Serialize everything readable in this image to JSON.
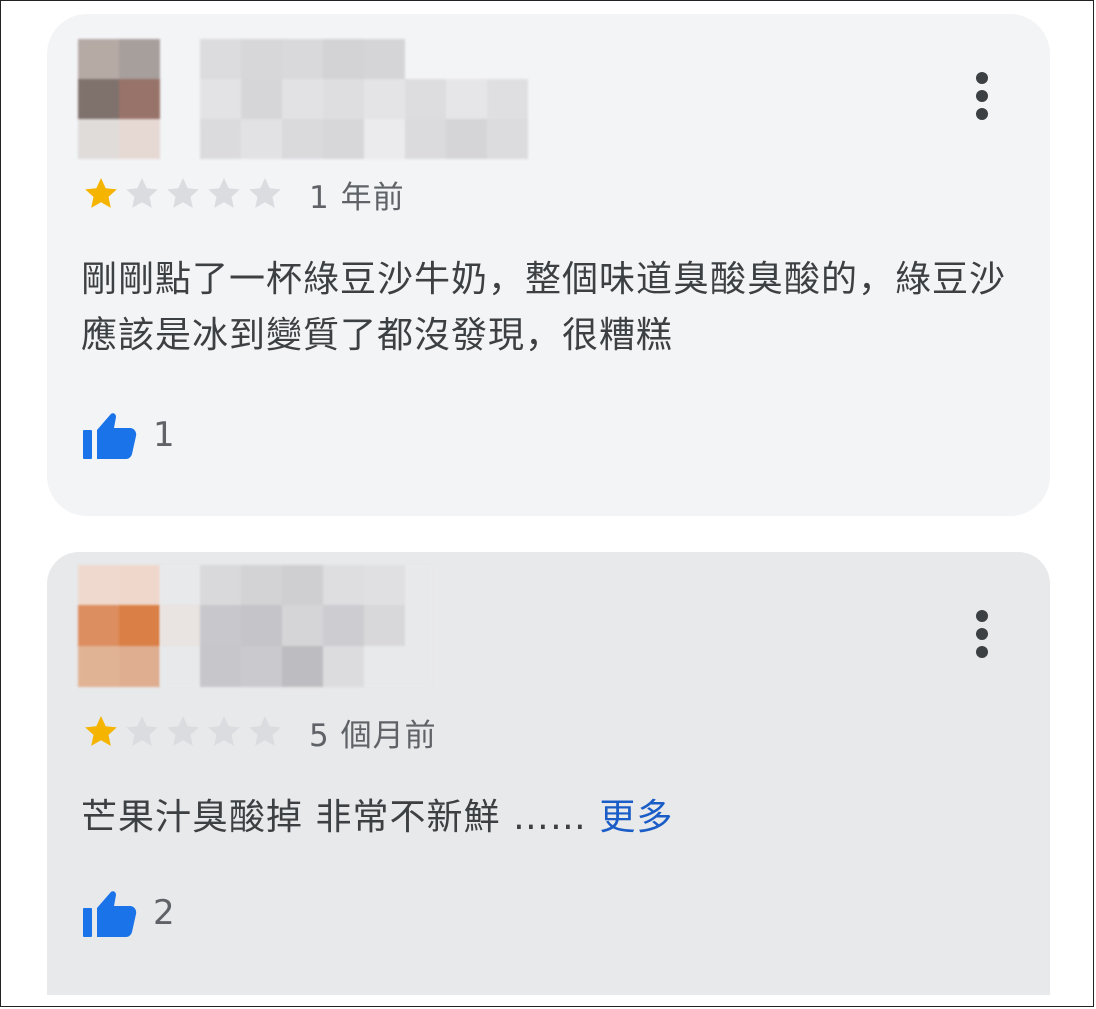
{
  "reviews": [
    {
      "avatar_label": "reviewer avatar (pixelated)",
      "name_label": "reviewer name (pixelated)",
      "rating": 1,
      "max_rating": 5,
      "time": "1 年前",
      "text": "剛剛點了一杯綠豆沙牛奶，整個味道臭酸臭酸的，綠豆沙應該是冰到變質了都沒發現，很糟糕",
      "more_label": "",
      "likes": "1"
    },
    {
      "avatar_label": "reviewer avatar (pixelated)",
      "name_label": "reviewer name (pixelated)",
      "rating": 1,
      "max_rating": 5,
      "time": "5 個月前",
      "text": "芒果汁臭酸掉 非常不新鮮 ……",
      "more_label": "更多",
      "likes": "2"
    }
  ],
  "icons": {
    "menu": "more-vert-icon",
    "star": "star-icon",
    "like": "thumbs-up-icon"
  },
  "colors": {
    "star_filled": "#f5b400",
    "star_empty": "#dadce0",
    "like": "#1a73e8",
    "link": "#1a5dc7"
  }
}
